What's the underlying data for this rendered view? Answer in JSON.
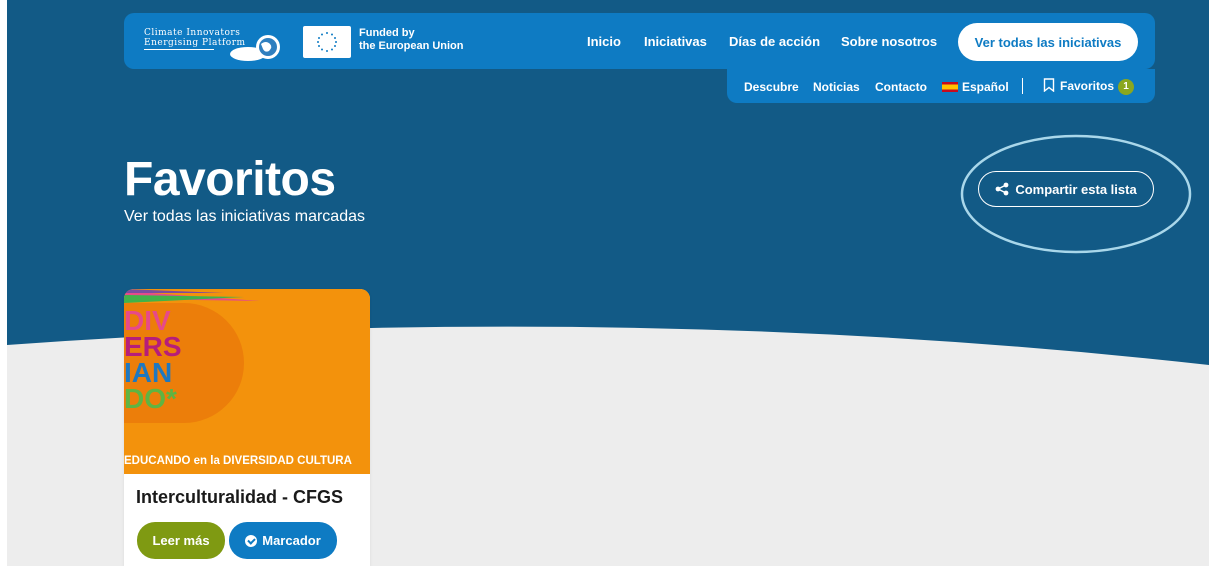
{
  "colors": {
    "hero": "#125a86",
    "nav": "#0e7bc3",
    "accent_green": "#7f9a12",
    "badge_green": "#8aa71f",
    "card_orange": "#f3920c"
  },
  "header": {
    "logo": {
      "line1": "Climate Innovators",
      "line2": "Energising Platform",
      "icon": "globe-cloud-icon"
    },
    "eu": {
      "line1": "Funded by",
      "line2": "the European Union",
      "icon": "eu-flag-icon"
    },
    "nav": {
      "inicio": "Inicio",
      "iniciativas": "Iniciativas",
      "dias": "Días de acción",
      "sobre": "Sobre nosotros"
    },
    "cta": "Ver todas las iniciativas",
    "subnav": {
      "descubre": "Descubre",
      "noticias": "Noticias",
      "contacto": "Contacto",
      "language": "Español",
      "favoritos": "Favoritos",
      "favoritos_count": "1"
    }
  },
  "hero": {
    "title": "Favoritos",
    "subtitle": "Ver todas las iniciativas marcadas",
    "share": "Compartir esta lista"
  },
  "card": {
    "image": {
      "letters": [
        "DIV",
        "ERS",
        "IAN",
        "DO*"
      ],
      "banner": "EDUCANDO en la DIVERSIDAD CULTURA"
    },
    "title": "Interculturalidad - CFGS",
    "read_more": "Leer más",
    "bookmark": "Marcador"
  }
}
